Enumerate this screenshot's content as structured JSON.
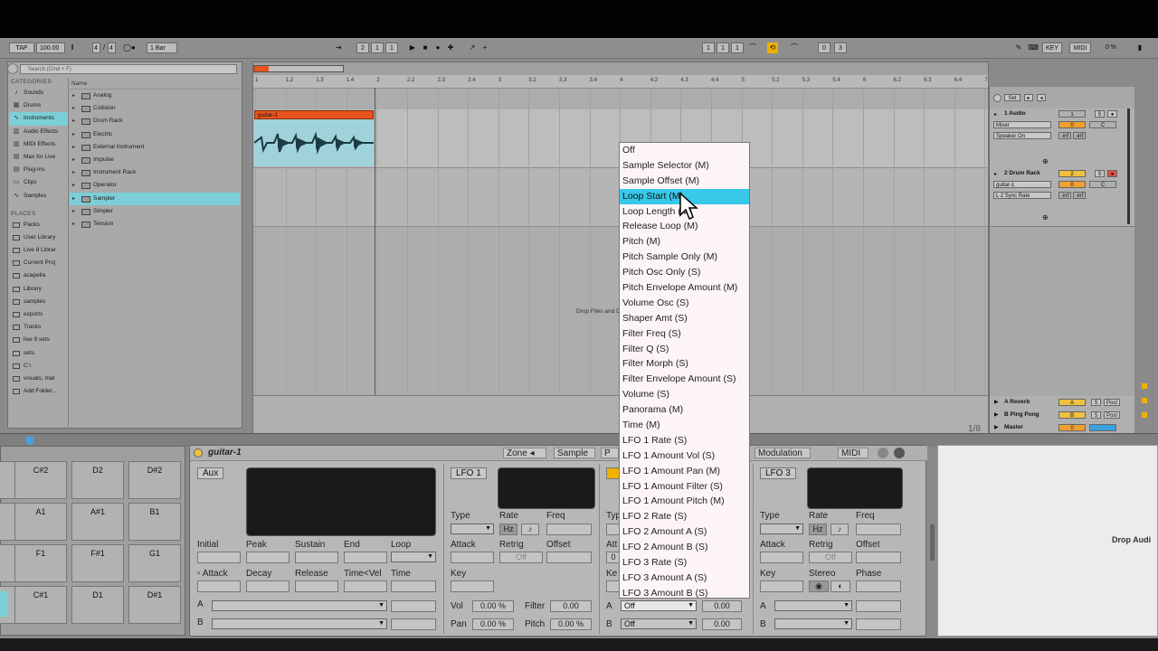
{
  "transport": {
    "tap": "TAP",
    "bpm": "100.00",
    "sig_num": "4",
    "sig_sep": "/",
    "sig_den": "4",
    "quant": "1 Bar",
    "pos1": "2",
    "pos2": "1",
    "pos3": "1",
    "loop1": "1",
    "loop2": "1",
    "loop3": "1",
    "len1": "0",
    "len2": "3",
    "key": "KEY",
    "midi": "MIDI",
    "cpu": "0 %"
  },
  "browser": {
    "search_placeholder": "Search (Cmd + F)",
    "categories_header": "CATEGORIES",
    "categories": [
      "Sounds",
      "Drums",
      "Instruments",
      "Audio Effects",
      "MIDI Effects",
      "Max for Live",
      "Plug-ins",
      "Clips",
      "Samples"
    ],
    "places_header": "PLACES",
    "places": [
      "Packs",
      "User Library",
      "Live 8 Librar",
      "Current Proj",
      "acapella",
      "Library",
      "samples",
      "exports",
      "Tracks",
      "live 9 sets",
      "sets",
      "C:\\",
      "visuals, mat",
      "Add Folder..."
    ],
    "items_header": "Name",
    "items": [
      "Analog",
      "Collision",
      "Drum Rack",
      "Electric",
      "External Instrument",
      "Impulse",
      "Instrument Rack",
      "Operator",
      "Sampler",
      "Simpler",
      "Tension"
    ]
  },
  "arrangement": {
    "ruler": [
      "1",
      "1.2",
      "1.3",
      "1.4",
      "2",
      "2.2",
      "2.3",
      "2.4",
      "3",
      "3.2",
      "3.3",
      "3.4",
      "4",
      "4.2",
      "4.3",
      "4.4",
      "5",
      "5.2",
      "5.3",
      "5.4",
      "6",
      "6.2",
      "6.3",
      "6.4",
      "7"
    ],
    "clip_name": "guitar-1",
    "drop_text": "Drop Files and Devices Here",
    "zoom_fraction": "1/8"
  },
  "mixer": {
    "set": "Set",
    "track1": {
      "name": "1 Audio",
      "input": "Mixer",
      "output": "Speaker On",
      "num": "1",
      "vol": "0",
      "pan": "C",
      "inf1": "-inf",
      "inf2": "-inf",
      "s": "S"
    },
    "track2": {
      "name": "2 Drum Rack",
      "input": "guitar-1",
      "output": "L 2 Sync Rate",
      "num": "2",
      "vol": "0",
      "pan": "C",
      "inf1": "-inf",
      "inf2": "-inf",
      "s": "S"
    },
    "returns": [
      {
        "name": "A Reverb",
        "letter": "A",
        "s": "S",
        "post": "Post"
      },
      {
        "name": "B Ping Pong",
        "letter": "B",
        "s": "S",
        "post": "Post"
      },
      {
        "name": "Master",
        "letter": "0",
        "s": "",
        "post": ""
      }
    ]
  },
  "menu": {
    "items": [
      "Off",
      "Sample Selector (M)",
      "Sample Offset (M)",
      "Loop Start (M)",
      "Loop Length (M)",
      "Release Loop (M)",
      "Pitch (M)",
      "Pitch Sample Only (M)",
      "Pitch Osc Only (S)",
      "Pitch Envelope Amount (M)",
      "Volume Osc (S)",
      "Shaper Amt (S)",
      "Filter Freq (S)",
      "Filter Q (S)",
      "Filter Morph (S)",
      "Filter Envelope Amount (S)",
      "Volume (S)",
      "Panorama (M)",
      "Time (M)",
      "LFO 1 Rate (S)",
      "LFO 1 Amount Vol (S)",
      "LFO 1 Amount Pan (M)",
      "LFO 1 Amount Filter (S)",
      "LFO 1 Amount Pitch (M)",
      "LFO 2 Rate (S)",
      "LFO 2 Amount A (S)",
      "LFO 2 Amount B (S)",
      "LFO 3 Rate (S)",
      "LFO 3 Amount A (S)",
      "LFO 3 Amount B (S)"
    ],
    "highlighted_index": 3
  },
  "pads": [
    "C#2",
    "D2",
    "D#2",
    "A1",
    "A#1",
    "B1",
    "F1",
    "F#1",
    "G1",
    "C#1",
    "D1",
    "D#1"
  ],
  "device": {
    "title": "guitar-1",
    "tabs": {
      "zone": "Zone",
      "sample": "Sample",
      "pitch": "P",
      "modulation": "Modulation",
      "midi": "MIDI"
    },
    "aux": "Aux",
    "env": {
      "initial": "Initial",
      "peak": "Peak",
      "sustain": "Sustain",
      "end": "End",
      "loop": "Loop",
      "attack": "Attack",
      "decay": "Decay",
      "release": "Release",
      "timevel": "Time<Vel",
      "time": "Time",
      "a": "A",
      "b": "B"
    },
    "lfo1": {
      "label": "LFO 1",
      "type": "Type",
      "rate": "Rate",
      "freq": "Freq",
      "hz": "Hz",
      "note": "♪",
      "attack": "Attack",
      "retrig": "Retrig",
      "offset": "Offset",
      "off": "Off",
      "key": "Key",
      "vol": "Vol",
      "vol_val": "0.00 %",
      "filter": "Filter",
      "filter_val": "0.00",
      "pan": "Pan",
      "pan_val": "0.00 %",
      "pitch": "Pitch",
      "pitch_val": "0.00 %"
    },
    "lfo2": {
      "type": "Typ",
      "att": "Att",
      "key": "Ke",
      "a": "A",
      "b": "B",
      "a_sel": "Off",
      "b_sel": "Off",
      "a_val": "0.00",
      "b_val": "0.00",
      "zero": "0"
    },
    "lfo3": {
      "label": "LFO 3",
      "type": "Type",
      "rate": "Rate",
      "freq": "Freq",
      "hz": "Hz",
      "note": "♪",
      "attack": "Attack",
      "retrig": "Retrig",
      "offset": "Offset",
      "off": "Off",
      "key": "Key",
      "stereo": "Stereo",
      "phase": "Phase",
      "a": "A",
      "b": "B"
    }
  },
  "drop_audio": "Drop Audi"
}
